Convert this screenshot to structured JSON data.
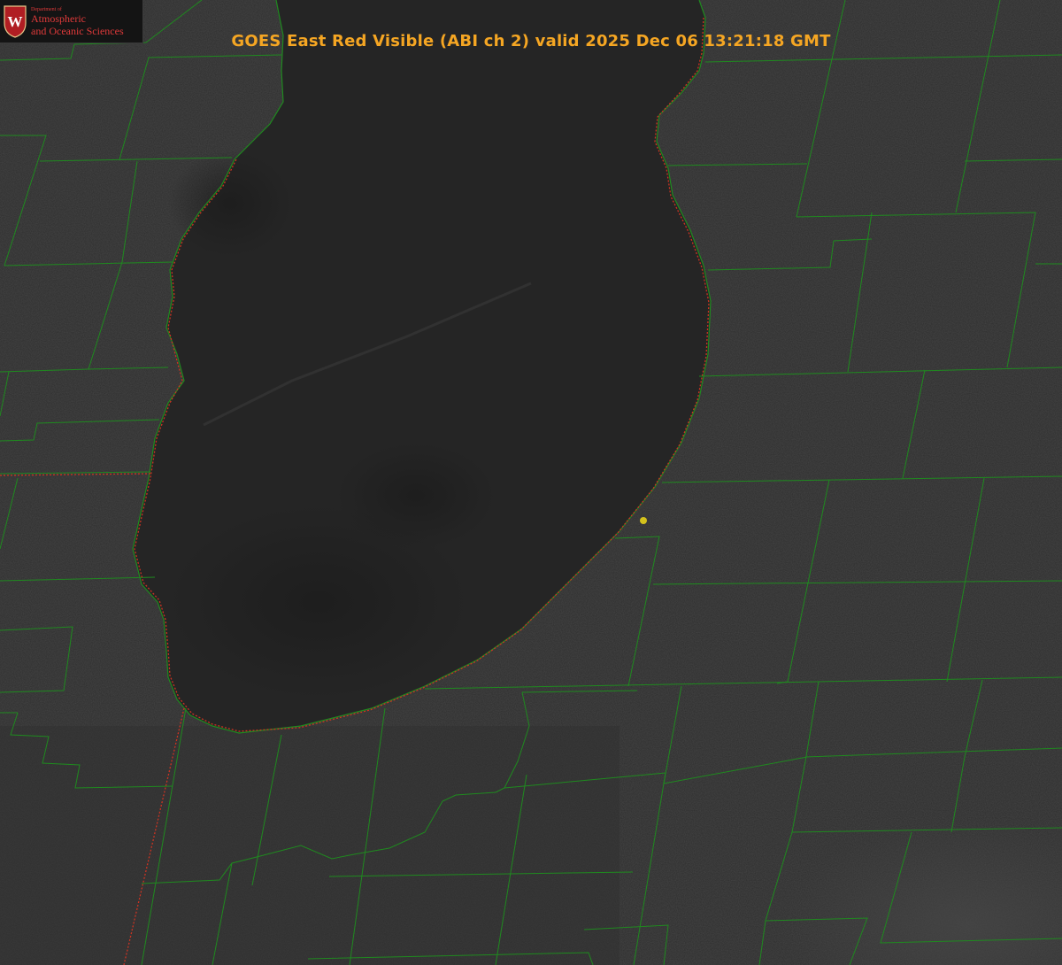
{
  "title": "GOES East Red Visible (ABI ch 2) valid 2025 Dec 06 13:21:18 GMT",
  "logo": {
    "department": "Department of",
    "line1": "Atmospheric",
    "line2": "and Oceanic Sciences",
    "crest_letter": "W"
  },
  "colors": {
    "title": "#f5a623",
    "county_lines": "#1f8a1f",
    "state_lines": "#cc3322",
    "marker": "#d4c21c",
    "logo_text": "#e03a3a",
    "crest": "#b01e23"
  }
}
